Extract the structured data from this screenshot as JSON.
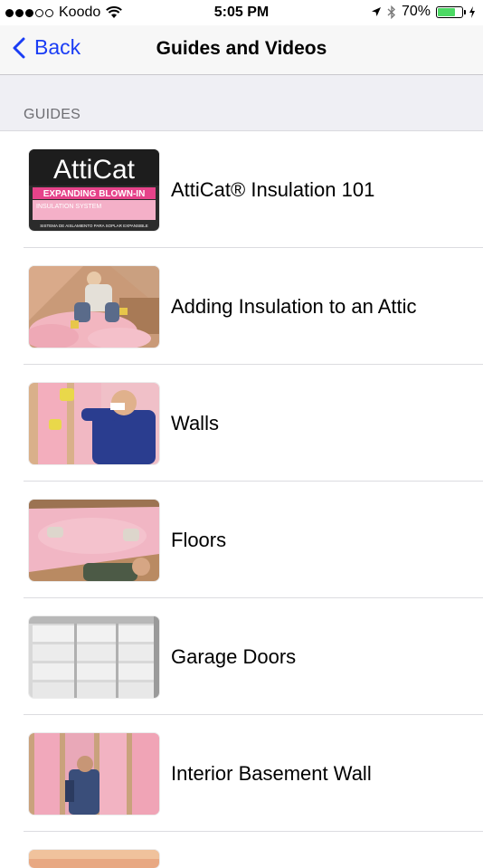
{
  "status_bar": {
    "carrier": "Koodo",
    "time": "5:05 PM",
    "battery_percent": "70%",
    "battery_level": 0.7,
    "signal_filled": 3,
    "signal_total": 5
  },
  "nav": {
    "back_label": "Back",
    "title": "Guides and Videos"
  },
  "section": {
    "header": "GUIDES"
  },
  "guides": [
    {
      "label": "AttiCat® Insulation 101",
      "thumb_title": "AttiCat",
      "thumb_subtitle": "EXPANDING BLOWN-IN",
      "thumb_line2": "INSULATION SYSTEM",
      "thumb_line3": "SISTEMA DE AISLAMIENTO PARA SOPLAR EXPANSIBLE"
    },
    {
      "label": "Adding Insulation to an Attic"
    },
    {
      "label": "Walls"
    },
    {
      "label": "Floors"
    },
    {
      "label": "Garage Doors"
    },
    {
      "label": "Interior Basement Wall"
    }
  ],
  "colors": {
    "accent": "#1a3df5",
    "insulation_pink": "#f2b6c0",
    "section_bg": "#efeff4",
    "battery_green": "#4cd964"
  }
}
